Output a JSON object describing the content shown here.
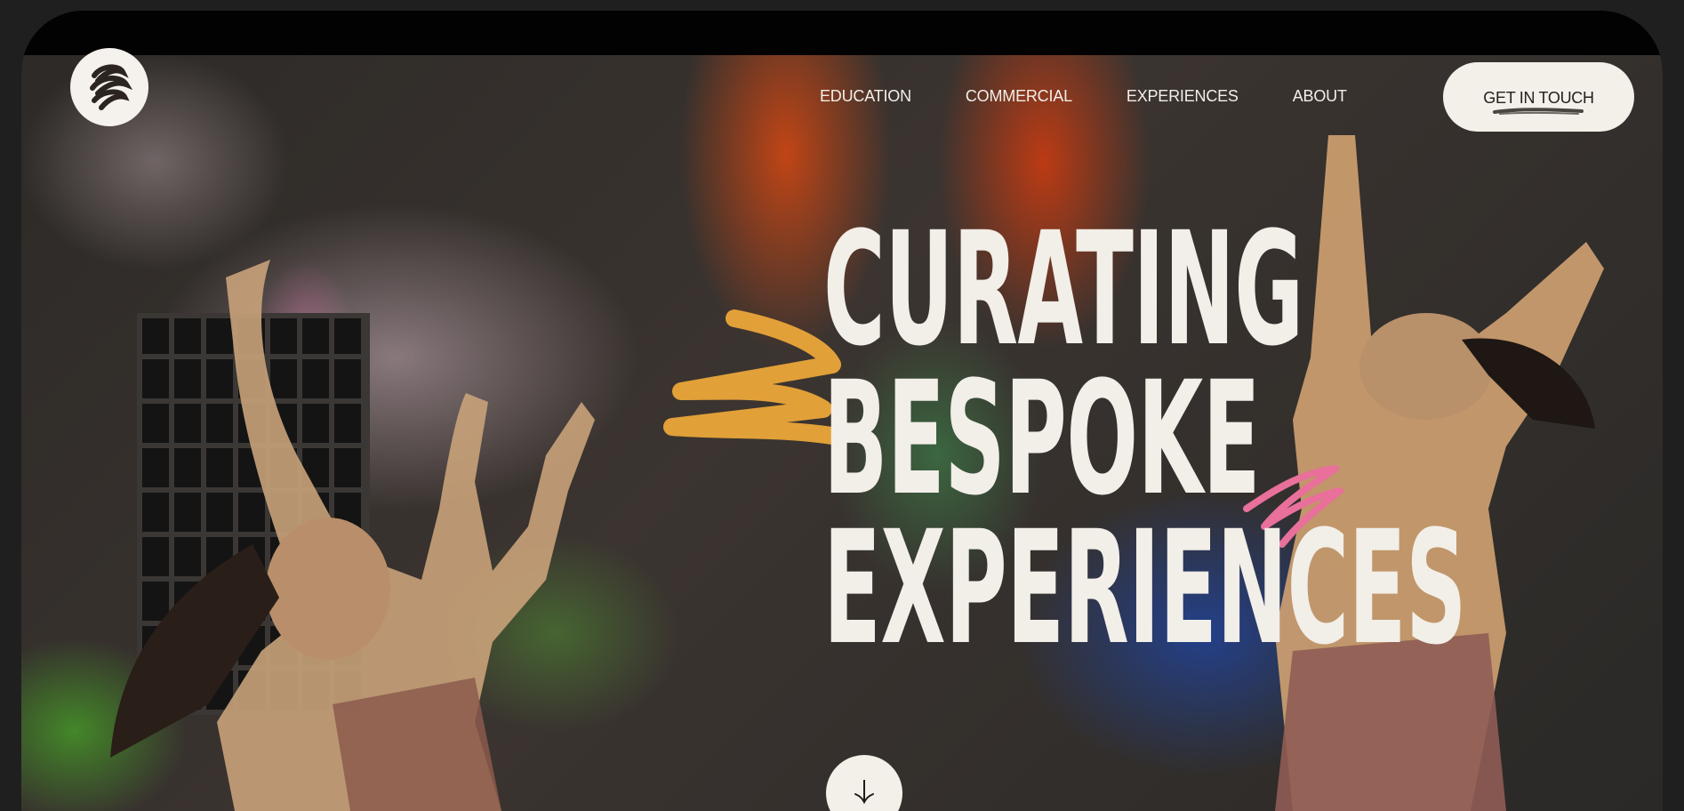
{
  "nav": {
    "items": [
      {
        "label": "EDUCATION"
      },
      {
        "label": "COMMERCIAL"
      },
      {
        "label": "EXPERIENCES"
      },
      {
        "label": "ABOUT"
      }
    ],
    "cta_label": "GET IN TOUCH"
  },
  "hero": {
    "headline_lines": [
      "CURATING",
      "BESPOKE",
      "EXPERIENCES"
    ]
  },
  "icons": {
    "logo": "wave-logo-icon",
    "scroll": "arrow-down-icon"
  },
  "colors": {
    "cream": "#f3efe9",
    "dark": "#23201d",
    "brush_yellow": "#f0a93a",
    "brush_pink": "#e8709a"
  }
}
